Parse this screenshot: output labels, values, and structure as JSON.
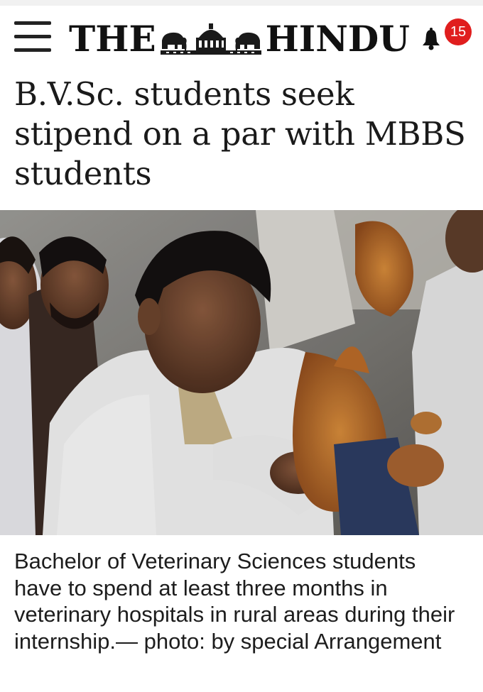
{
  "header": {
    "logo_text_left": "THE",
    "logo_text_right": "HINDU",
    "notification_count": "15",
    "menu_icon": "hamburger-menu-icon",
    "bell_icon": "bell-icon",
    "badge_color": "#e01e1e"
  },
  "article": {
    "headline": "B.V.Sc. students seek stipend on a par with MBBS students",
    "caption": "Bachelor of Veterinary Sciences students have to spend at least three months in veterinary hospitals in rural areas during their internship.— photo: by special Arrangement"
  }
}
